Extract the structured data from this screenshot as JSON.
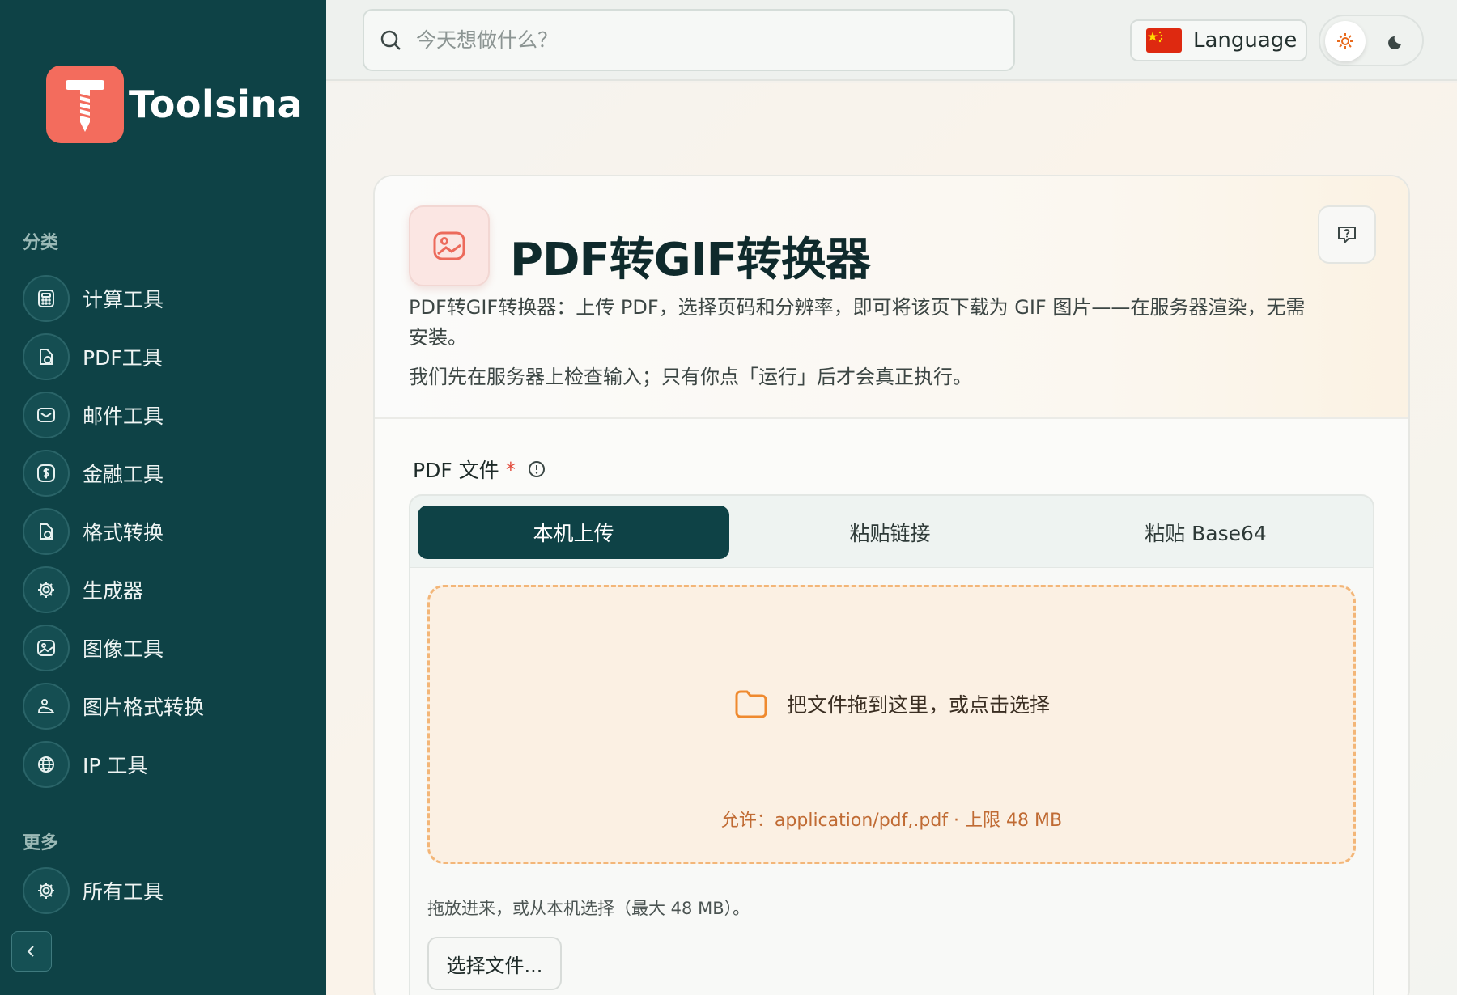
{
  "brand": {
    "name": "Toolsina"
  },
  "sidebar": {
    "section_categories": "分类",
    "items": [
      {
        "label": "计算工具",
        "icon": "calculator-icon"
      },
      {
        "label": "PDF工具",
        "icon": "document-icon"
      },
      {
        "label": "邮件工具",
        "icon": "mail-icon"
      },
      {
        "label": "金融工具",
        "icon": "dollar-icon"
      },
      {
        "label": "格式转换",
        "icon": "convert-icon"
      },
      {
        "label": "生成器",
        "icon": "gear-icon"
      },
      {
        "label": "图像工具",
        "icon": "image-icon"
      },
      {
        "label": "图片格式转换",
        "icon": "image-convert-icon"
      },
      {
        "label": "IP 工具",
        "icon": "globe-icon"
      }
    ],
    "section_more": "更多",
    "more_items": [
      {
        "label": "所有工具",
        "icon": "gear-icon"
      }
    ]
  },
  "topbar": {
    "search_placeholder": "今天想做什么？",
    "language_label": "Language"
  },
  "tool": {
    "title": "PDF转GIF转换器",
    "description": "PDF转GIF转换器：上传 PDF，选择页码和分辨率，即可将该页下载为 GIF 图片——在服务器渲染，无需安装。",
    "description2": "我们先在服务器上检查输入；只有你点「运行」后才会真正执行。"
  },
  "form": {
    "field_label": "PDF 文件",
    "required_mark": "*",
    "tabs": [
      "本机上传",
      "粘贴链接",
      "粘贴 Base64"
    ],
    "drop_text": "把文件拖到这里，或点击选择",
    "allow_text": "允许：application/pdf,.pdf · 上限 48 MB",
    "hint": "拖放进来，或从本机选择（最大 48 MB）。",
    "choose_button": "选择文件..."
  },
  "colors": {
    "sidebar_bg": "#0e4246",
    "accent_coral": "#f36c5d",
    "dropzone_border": "#f3b678",
    "dropzone_bg": "#fbf0e3"
  }
}
